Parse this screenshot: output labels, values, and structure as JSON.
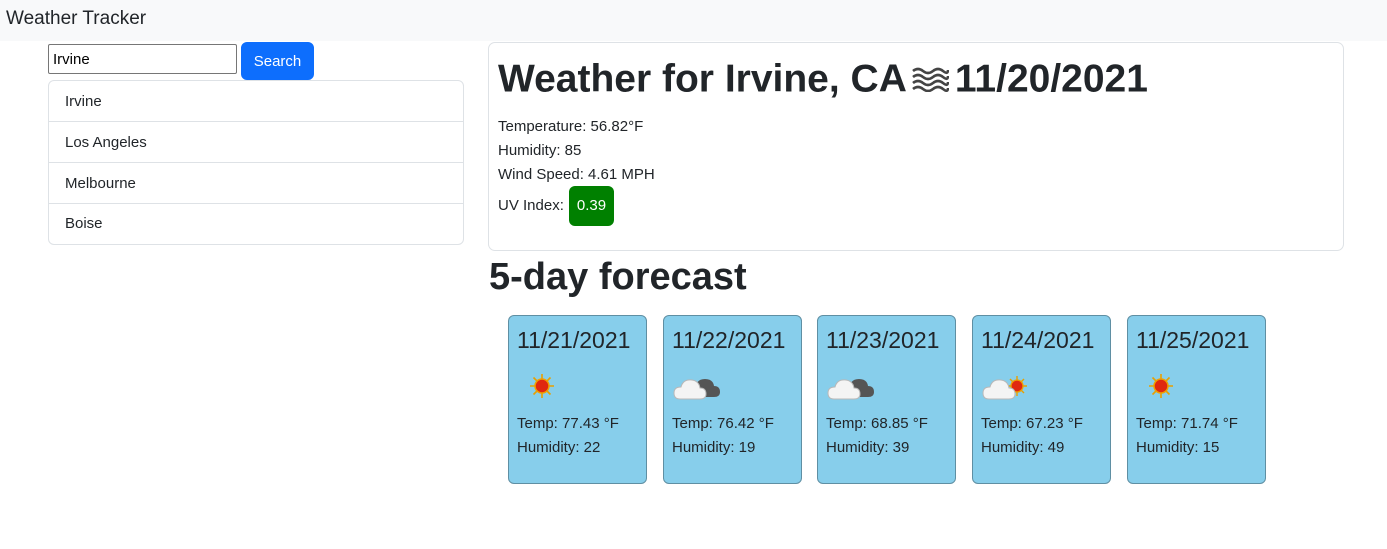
{
  "navbar": {
    "brand": "Weather Tracker"
  },
  "search": {
    "value": "Irvine",
    "button_label": "Search"
  },
  "history": [
    "Irvine",
    "Los Angeles",
    "Melbourne",
    "Boise"
  ],
  "current": {
    "title_prefix": "Weather for Irvine, CA",
    "icon": "mist-icon",
    "date": "11/20/2021",
    "temperature": "Temperature: 56.82°F",
    "humidity": "Humidity: 85",
    "wind": "Wind Speed: 4.61 MPH",
    "uv_label": "UV Index:",
    "uv_value": "0.39",
    "uv_color": "#008000"
  },
  "forecast": {
    "heading": "5-day forecast",
    "card_color": "#87ceeb",
    "days": [
      {
        "date": "11/21/2021",
        "icon": "sun-icon",
        "temp": "Temp: 77.43 °F",
        "humidity": "Humidity: 22"
      },
      {
        "date": "11/22/2021",
        "icon": "cloud-icon",
        "temp": "Temp: 76.42 °F",
        "humidity": "Humidity: 19"
      },
      {
        "date": "11/23/2021",
        "icon": "cloud-icon",
        "temp": "Temp: 68.85 °F",
        "humidity": "Humidity: 39"
      },
      {
        "date": "11/24/2021",
        "icon": "partly-cloudy-icon",
        "temp": "Temp: 67.23 °F",
        "humidity": "Humidity: 49"
      },
      {
        "date": "11/25/2021",
        "icon": "sun-icon",
        "temp": "Temp: 71.74 °F",
        "humidity": "Humidity: 15"
      }
    ]
  }
}
